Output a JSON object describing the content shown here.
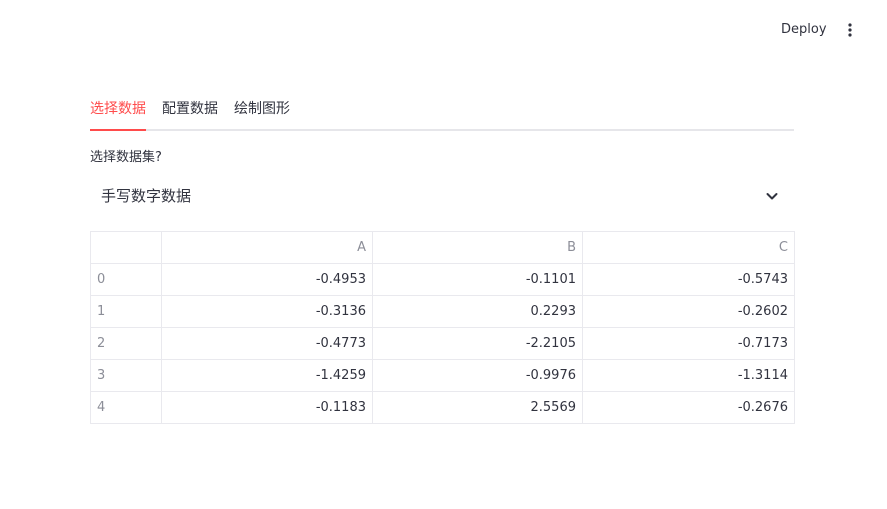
{
  "header": {
    "deploy_label": "Deploy",
    "menu_icon": "vertical-ellipsis-icon"
  },
  "tabs": [
    {
      "label": "选择数据",
      "active": true
    },
    {
      "label": "配置数据",
      "active": false
    },
    {
      "label": "绘制图形",
      "active": false
    }
  ],
  "select": {
    "label": "选择数据集?",
    "value": "手写数字数据",
    "icon": "chevron-down-icon"
  },
  "table": {
    "columns": [
      "",
      "A",
      "B",
      "C"
    ],
    "rows": [
      {
        "index": "0",
        "A": "-0.4953",
        "B": "-0.1101",
        "C": "-0.5743"
      },
      {
        "index": "1",
        "A": "-0.3136",
        "B": "0.2293",
        "C": "-0.2602"
      },
      {
        "index": "2",
        "A": "-0.4773",
        "B": "-2.2105",
        "C": "-0.7173"
      },
      {
        "index": "3",
        "A": "-1.4259",
        "B": "-0.9976",
        "C": "-1.3114"
      },
      {
        "index": "4",
        "A": "-0.1183",
        "B": "2.5569",
        "C": "-0.2676"
      }
    ]
  },
  "colors": {
    "accent": "#ff4b4b",
    "text": "#31333f",
    "muted": "#8c8e98",
    "border": "#e9e9ee"
  }
}
